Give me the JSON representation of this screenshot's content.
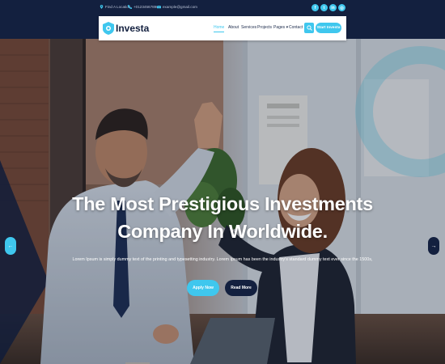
{
  "topbar": {
    "location": "Find A Location",
    "phone": "+01234567890",
    "email": "example@gmail.com",
    "social": [
      {
        "icon": "facebook-icon",
        "glyph": "f"
      },
      {
        "icon": "twitter-icon",
        "glyph": "t"
      },
      {
        "icon": "linkedin-icon",
        "glyph": "in"
      },
      {
        "icon": "instagram-icon",
        "glyph": "◎"
      }
    ]
  },
  "navbar": {
    "logo": "Investa",
    "items": [
      {
        "label": "Home",
        "active": true
      },
      {
        "label": "About",
        "active": false
      },
      {
        "label": "Services",
        "active": false
      },
      {
        "label": "Projects",
        "active": false
      },
      {
        "label": "Pages ▾",
        "active": false
      },
      {
        "label": "Contact",
        "active": false
      }
    ],
    "cta": "Start Investa"
  },
  "hero": {
    "title": "The Most Prestigious Investments Company In Worldwide.",
    "description": "Lorem Ipsum is simply dummy text of the printing and typesetting industry. Lorem Ipsum has been the industry's standard dummy text ever since the 1500s,",
    "primary_button": "Apply Now",
    "secondary_button": "Read More",
    "prev": "←",
    "next": "→"
  },
  "colors": {
    "primary": "#3fc7ee",
    "dark": "#13203f",
    "white": "#ffffff"
  }
}
